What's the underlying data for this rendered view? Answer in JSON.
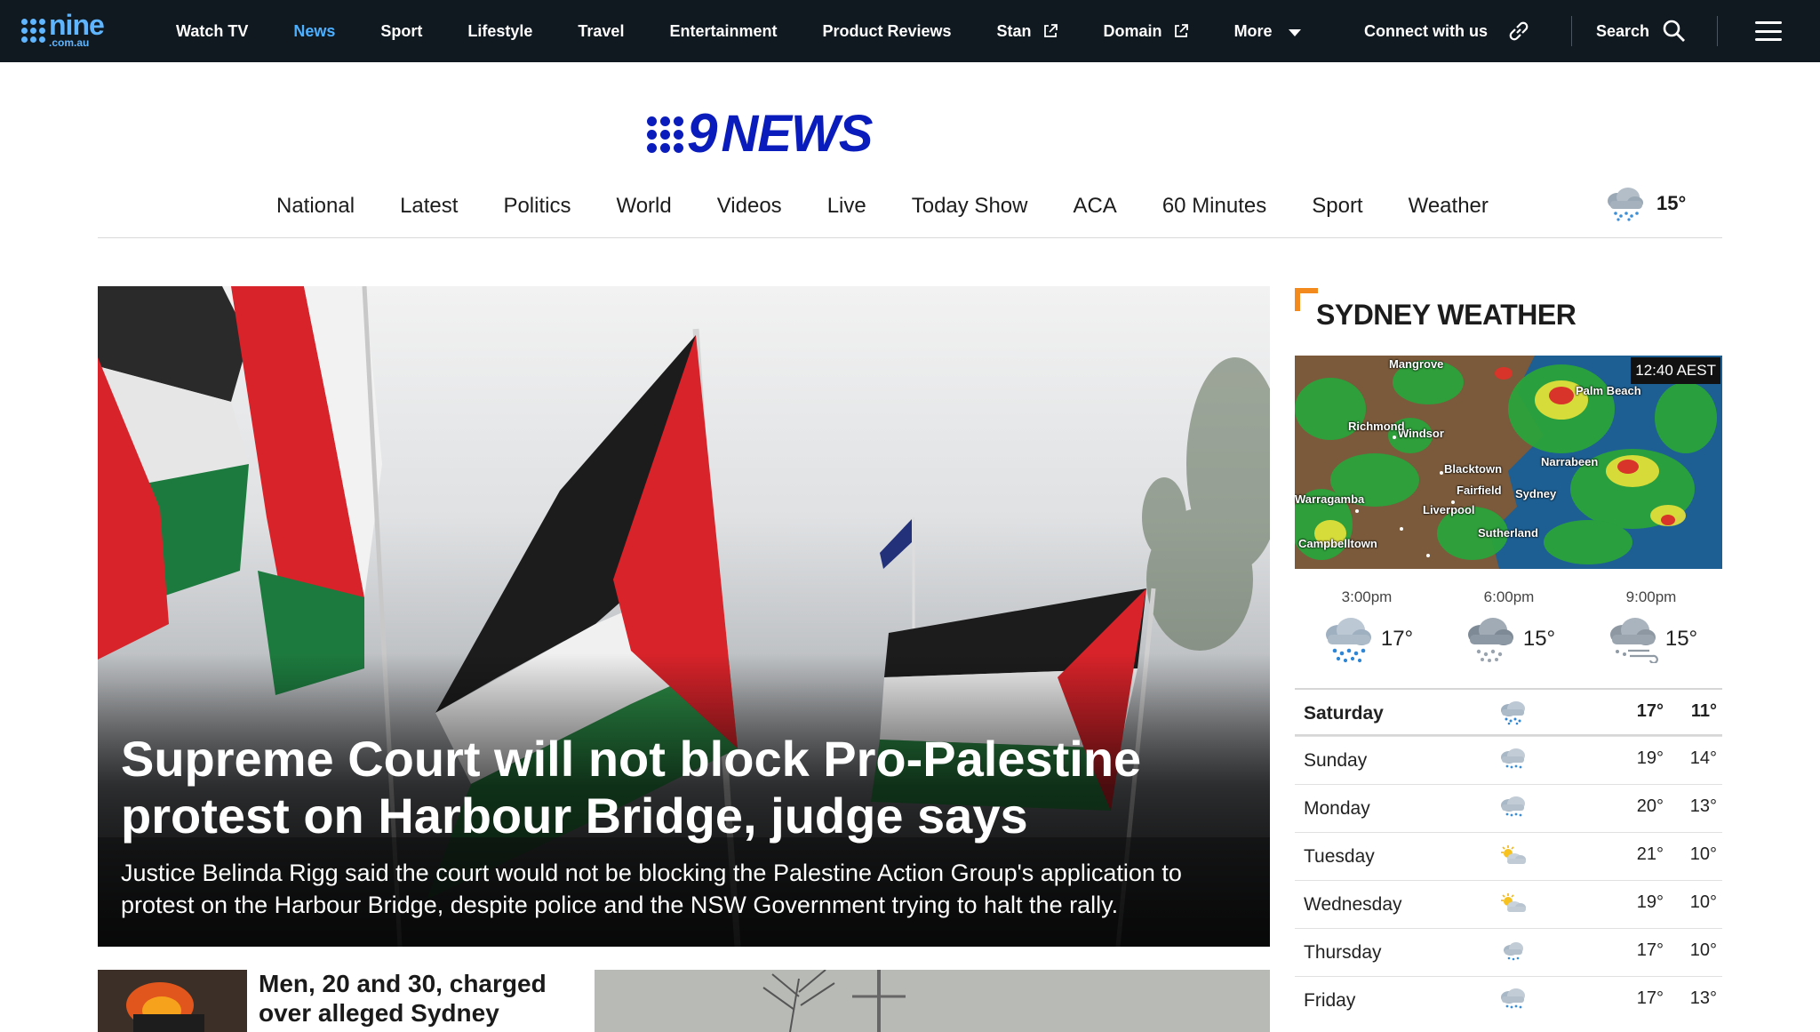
{
  "topbar": {
    "brand_line1": "nine",
    "brand_line2": ".com.au",
    "nav": [
      {
        "label": "Watch TV",
        "active": false
      },
      {
        "label": "News",
        "active": true
      },
      {
        "label": "Sport",
        "active": false
      },
      {
        "label": "Lifestyle",
        "active": false
      },
      {
        "label": "Travel",
        "active": false
      },
      {
        "label": "Entertainment",
        "active": false
      },
      {
        "label": "Product Reviews",
        "active": false
      },
      {
        "label": "Stan",
        "active": false
      },
      {
        "label": "Domain",
        "active": false
      },
      {
        "label": "More",
        "active": false
      }
    ],
    "connect_label": "Connect with us",
    "search_label": "Search"
  },
  "logo": {
    "nine": "9",
    "news": "NEWS"
  },
  "section_nav": [
    "National",
    "Latest",
    "Politics",
    "World",
    "Videos",
    "Live",
    "Today Show",
    "ACA",
    "60 Minutes",
    "Sport",
    "Weather"
  ],
  "nav_weather": {
    "temp": "15°",
    "icon": "rain-cloud-icon"
  },
  "hero": {
    "title": "Supreme Court will not block Pro-Palestine protest on Harbour Bridge, judge says",
    "description": "Justice Belinda Rigg said the court would not be blocking the Palestine Action Group's application to protest on the Harbour Bridge, despite police and the NSW Government trying to halt the rally."
  },
  "stories": [
    {
      "title": "Men, 20 and 30, charged over alleged Sydney"
    }
  ],
  "weather": {
    "title": "SYDNEY WEATHER",
    "radar_time": "12:40 AEST",
    "radar_places": [
      "Mangrove",
      "Windsor",
      "Blacktown",
      "Fairfield",
      "Sydney",
      "Sutherland",
      "Narrabeen",
      "Warragamba",
      "Campbelltown",
      "Richmond",
      "Liverpool",
      "Palm Beach"
    ],
    "hourly": [
      {
        "time": "3:00pm",
        "temp": "17°",
        "icon": "heavy-rain-icon"
      },
      {
        "time": "6:00pm",
        "temp": "15°",
        "icon": "rain-cloud-icon"
      },
      {
        "time": "9:00pm",
        "temp": "15°",
        "icon": "windy-rain-icon"
      }
    ],
    "daily": [
      {
        "day": "Saturday",
        "hi": "17°",
        "lo": "11°",
        "icon": "rain-icon"
      },
      {
        "day": "Sunday",
        "hi": "19°",
        "lo": "14°",
        "icon": "shower-icon"
      },
      {
        "day": "Monday",
        "hi": "20°",
        "lo": "13°",
        "icon": "shower-icon"
      },
      {
        "day": "Tuesday",
        "hi": "21°",
        "lo": "10°",
        "icon": "partly-sunny-icon"
      },
      {
        "day": "Wednesday",
        "hi": "19°",
        "lo": "10°",
        "icon": "partly-sunny-icon"
      },
      {
        "day": "Thursday",
        "hi": "17°",
        "lo": "10°",
        "icon": "light-shower-icon"
      },
      {
        "day": "Friday",
        "hi": "17°",
        "lo": "13°",
        "icon": "shower-icon"
      }
    ]
  },
  "colors": {
    "topbar_bg": "#101820",
    "active_nav": "#4db0ff",
    "brand_blue": "#0a1cbb",
    "accent_orange": "#f28a1e"
  }
}
